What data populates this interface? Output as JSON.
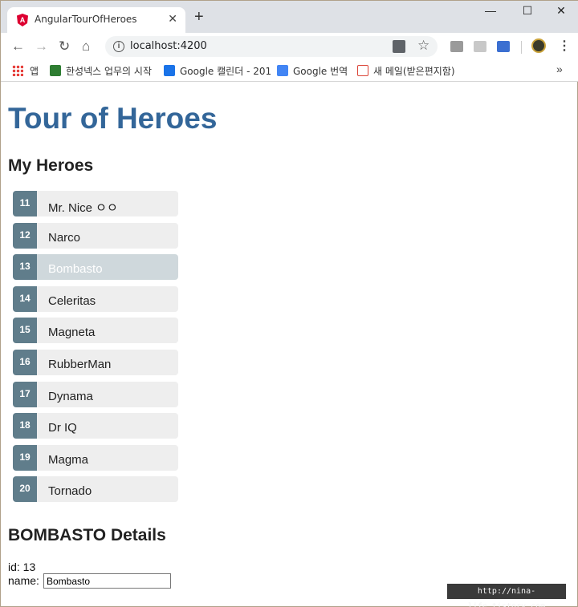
{
  "browser": {
    "tab_title": "AngularTourOfHeroes",
    "tab_close": "✕",
    "new_tab": "+",
    "window_controls": {
      "minimize": "—",
      "maximize": "☐",
      "close": "✕"
    },
    "url": "localhost:4200",
    "nav": {
      "back": "←",
      "forward": "→",
      "reload": "↻",
      "home": "⌂"
    },
    "star": "☆",
    "menu": "⋮",
    "bookmarks": [
      {
        "label": "앱",
        "icon": "apps-grid-icon",
        "color": "#e53935"
      },
      {
        "label": "한성넥스 업무의 시작",
        "icon": "company-icon",
        "color": "#2e7d32"
      },
      {
        "label": "Google 캘린더 - 201",
        "icon": "calendar-icon",
        "color": "#1a73e8"
      },
      {
        "label": "Google 번역",
        "icon": "translate-icon",
        "color": "#4285f4"
      },
      {
        "label": "새 메일(받은편지함)",
        "icon": "mail-icon",
        "color": "#db4437"
      }
    ],
    "bookmarks_more": "»"
  },
  "app": {
    "title": "Tour of Heroes",
    "heroes_heading": "My Heroes",
    "heroes": [
      {
        "id": "11",
        "name": "Mr. Nice ㅇㅇ"
      },
      {
        "id": "12",
        "name": "Narco"
      },
      {
        "id": "13",
        "name": "Bombasto",
        "selected": true
      },
      {
        "id": "14",
        "name": "Celeritas"
      },
      {
        "id": "15",
        "name": "Magneta"
      },
      {
        "id": "16",
        "name": "RubberMan"
      },
      {
        "id": "17",
        "name": "Dynama"
      },
      {
        "id": "18",
        "name": "Dr IQ"
      },
      {
        "id": "19",
        "name": "Magma"
      },
      {
        "id": "20",
        "name": "Tornado"
      }
    ],
    "details_heading": "BOMBASTO Details",
    "id_label": "id: 13",
    "name_label": "name:",
    "name_value": "Bombasto"
  },
  "watermark": "http://nina-life.tistory.com",
  "colors": {
    "title": "#336699",
    "badge": "#607d8b",
    "selected": "#cfd8dc",
    "item": "#eeeeee"
  }
}
